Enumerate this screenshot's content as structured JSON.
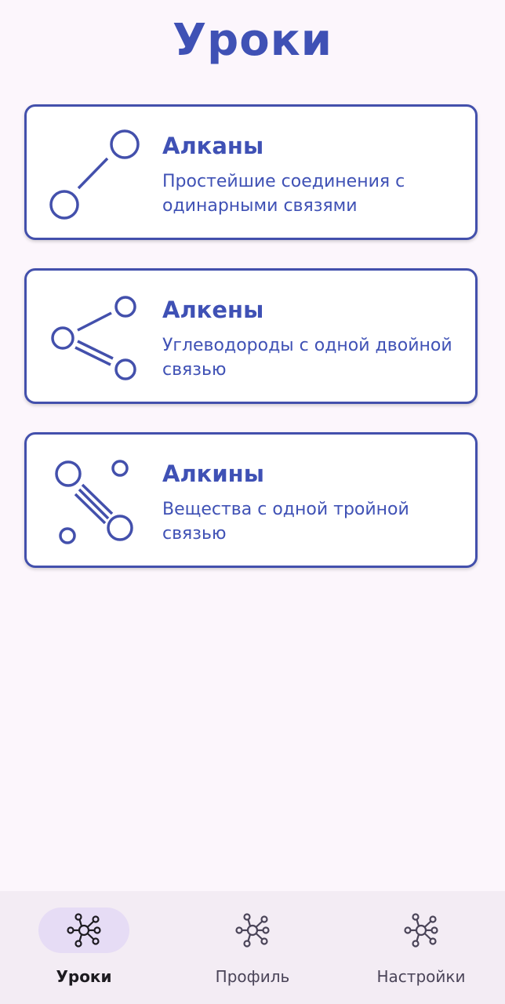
{
  "header": {
    "title": "Уроки"
  },
  "lessons": [
    {
      "title": "Алканы",
      "description": "Простейшие соединения с одинарными связями",
      "icon": "single-bond-icon"
    },
    {
      "title": "Алкены",
      "description": "Углеводороды с одной двойной связью",
      "icon": "double-bond-icon"
    },
    {
      "title": "Алкины",
      "description": "Вещества с одной тройной связью",
      "icon": "triple-bond-icon"
    }
  ],
  "bottom_nav": {
    "items": [
      {
        "label": "Уроки",
        "icon": "molecule-icon",
        "active": true
      },
      {
        "label": "Профиль",
        "icon": "molecule-icon",
        "active": false
      },
      {
        "label": "Настройки",
        "icon": "molecule-icon",
        "active": false
      }
    ]
  },
  "colors": {
    "accent": "#3f51b5",
    "card_border": "#4350ac",
    "background": "#fcf6fc",
    "nav_background": "#f3ecf4",
    "nav_active_pill": "#e6dcf5"
  }
}
